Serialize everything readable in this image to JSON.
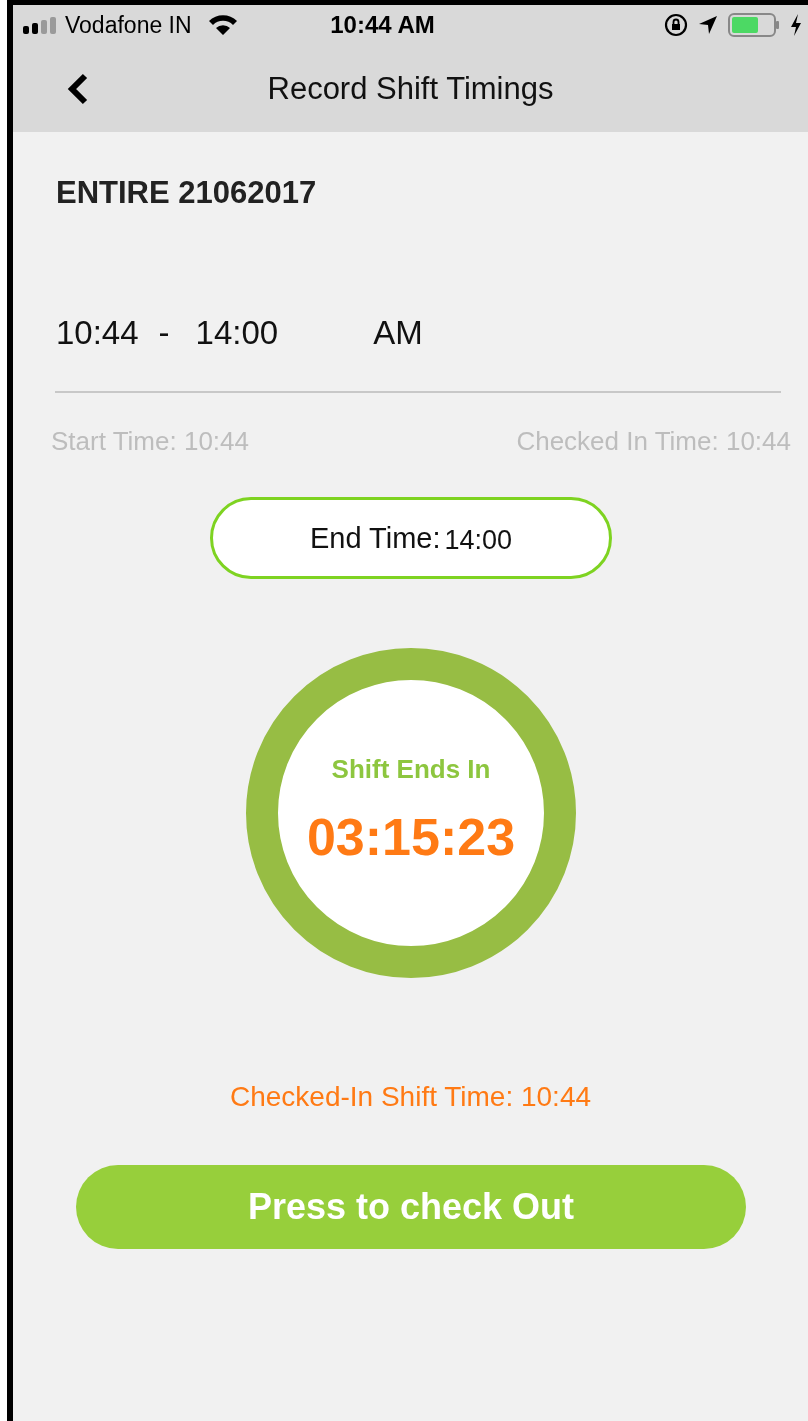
{
  "status_bar": {
    "carrier": "Vodafone IN",
    "time": "10:44 AM"
  },
  "nav": {
    "title": "Record Shift Timings"
  },
  "shift": {
    "name": "ENTIRE 21062017",
    "start": "10:44",
    "separator": "-",
    "end": "14:00",
    "period": "AM"
  },
  "info": {
    "start_time": "Start Time: 10:44",
    "checked_in_time": "Checked In Time: 10:44"
  },
  "end_time": {
    "label": "End Time:",
    "value": "14:00"
  },
  "timer": {
    "label": "Shift Ends In",
    "value": "03:15:23"
  },
  "checked_in_shift": "Checked-In Shift Time: 10:44",
  "checkout_button": "Press to check Out"
}
